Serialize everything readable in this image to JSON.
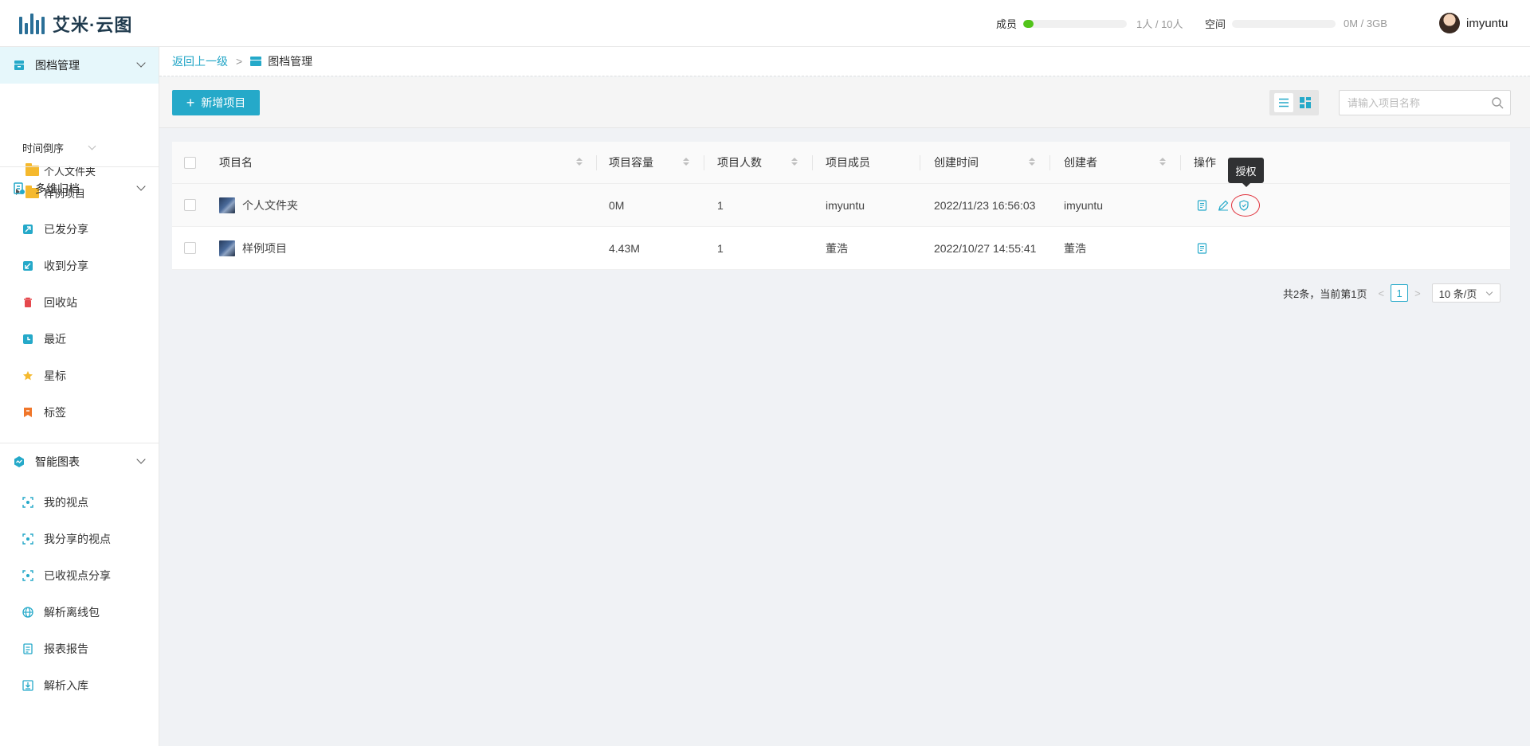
{
  "app": {
    "logo_text": "艾米·云图",
    "brand_color": "#25a9c9",
    "quota": {
      "members_label": "成员",
      "members_text": "1人 / 10人",
      "members_fraction": 0.1,
      "space_label": "空间",
      "space_text": "0M / 3GB",
      "space_fraction": 0.0
    },
    "user": {
      "name": "imyuntu"
    }
  },
  "sidebar": {
    "sections": [
      {
        "title": "图档管理",
        "icon": "archive-icon",
        "active": true
      },
      {
        "title": "多维归档",
        "icon": "multi-archive-icon",
        "active": false
      },
      {
        "title": "智能图表",
        "icon": "smart-chart-icon",
        "active": false
      }
    ],
    "tree": {
      "sort_label": "时间倒序",
      "items": [
        {
          "label": "个人文件夹",
          "icon": "folder-icon"
        },
        {
          "label": "样例项目",
          "icon": "folder-icon"
        }
      ]
    },
    "archive_items": [
      {
        "label": "已发分享",
        "icon": "share-out-icon"
      },
      {
        "label": "收到分享",
        "icon": "share-in-icon"
      },
      {
        "label": "回收站",
        "icon": "trash-icon"
      },
      {
        "label": "最近",
        "icon": "clock-icon"
      },
      {
        "label": "星标",
        "icon": "star-icon"
      },
      {
        "label": "标签",
        "icon": "tag-icon"
      }
    ],
    "chart_items": [
      {
        "label": "我的视点",
        "icon": "viewpoint-icon"
      },
      {
        "label": "我分享的视点",
        "icon": "viewpoint-share-icon"
      },
      {
        "label": "已收视点分享",
        "icon": "viewpoint-received-icon"
      },
      {
        "label": "解析离线包",
        "icon": "globe-icon"
      },
      {
        "label": "报表报告",
        "icon": "report-icon"
      },
      {
        "label": "解析入库",
        "icon": "import-icon"
      }
    ]
  },
  "breadcrumb": {
    "back": "返回上一级",
    "separator": ">",
    "current": "图档管理"
  },
  "toolbar": {
    "add_label": "新增项目",
    "search_placeholder": "请输入项目名称"
  },
  "table": {
    "columns": [
      "项目名",
      "项目容量",
      "项目人数",
      "项目成员",
      "创建时间",
      "创建者",
      "操作"
    ],
    "rows": [
      {
        "name": "个人文件夹",
        "size": "0M",
        "count": "1",
        "members": "imyuntu",
        "created": "2022/11/23 16:56:03",
        "creator": "imyuntu"
      },
      {
        "name": "样例项目",
        "size": "4.43M",
        "count": "1",
        "members": "董浩",
        "created": "2022/10/27 14:55:41",
        "creator": "董浩"
      }
    ],
    "tooltip": "授权"
  },
  "pagination": {
    "summary": "共2条，当前第1页",
    "prev": "<",
    "page": "1",
    "next": ">",
    "page_size": "10 条/页"
  }
}
